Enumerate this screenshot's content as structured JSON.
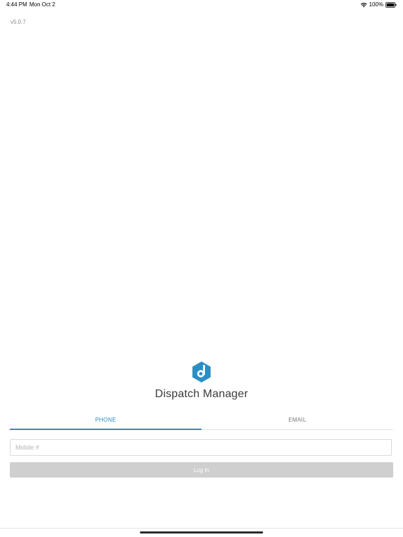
{
  "status_bar": {
    "time": "4:44 PM",
    "date": "Mon Oct 2",
    "battery_percent": "100%",
    "icons": [
      "wifi-icon",
      "battery-icon"
    ]
  },
  "app": {
    "version": "v5.0.7",
    "title": "Dispatch Manager",
    "logo": "dispatch-logo-icon",
    "brand_color": "#2a8fc4"
  },
  "tabs": [
    {
      "label": "PHONE",
      "active": true
    },
    {
      "label": "EMAIL",
      "active": false
    }
  ],
  "form": {
    "mobile_value": "",
    "mobile_placeholder": "Mobile #",
    "login_label": "Log In",
    "login_enabled": false
  }
}
